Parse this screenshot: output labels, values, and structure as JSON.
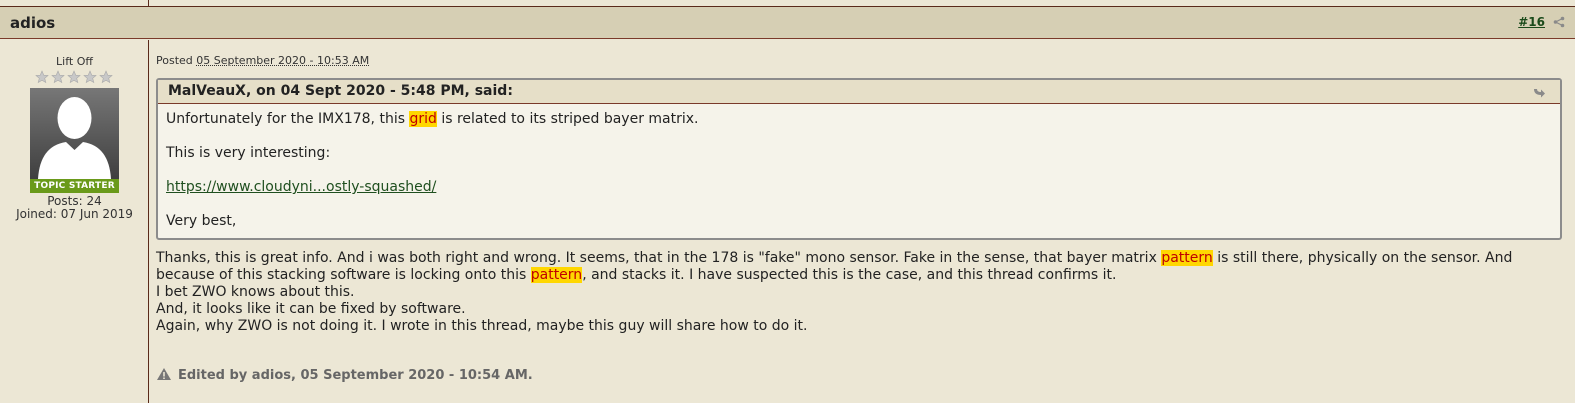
{
  "post": {
    "author": "adios",
    "number": "#16",
    "posted_prefix": "Posted",
    "posted_date": "05 September 2020 - 10:53 AM",
    "edited_note": "Edited by adios, 05 September 2020 - 10:54 AM."
  },
  "author_info": {
    "member_title": "Lift Off",
    "rating_stars": 0,
    "badge": "TOPIC STARTER",
    "posts": "Posts:  24",
    "joined": "Joined:  07 Jun 2019"
  },
  "quote": {
    "header": "MalVeauX, on 04 Sept 2020 - 5:48 PM, said:",
    "line1_before": "Unfortunately for the IMX178, this",
    "line1_highlight": "grid",
    "line1_after": "is related to its striped bayer matrix.",
    "line2": "This is very interesting:",
    "link": "https://www.cloudyni...ostly-squashed/",
    "line4": "Very best,"
  },
  "body": {
    "p1_a": "Thanks, this is great info. And i was both right and wrong. It seems, that in the 178 is \"fake\" mono sensor. Fake in the sense, that bayer matrix",
    "p1_hl1": "pattern",
    "p1_b": "is still there, physically on the sensor. And because of this stacking software is locking onto this",
    "p1_hl2": "pattern",
    "p1_c": ", and stacks it. I have suspected this is the case, and this thread confirms it.",
    "l2": "I bet ZWO knows about this.",
    "l3": "And, it looks like it can be fixed by software.",
    "l4": "Again, why ZWO is not doing it. I wrote in this thread, maybe this guy will share how to do it."
  },
  "colors": {
    "background": "#ece7d5",
    "header_bg": "#d6cfb4",
    "badge_green": "#6a9a1a",
    "highlight_bg": "#ffd700",
    "highlight_text": "#c00000"
  }
}
